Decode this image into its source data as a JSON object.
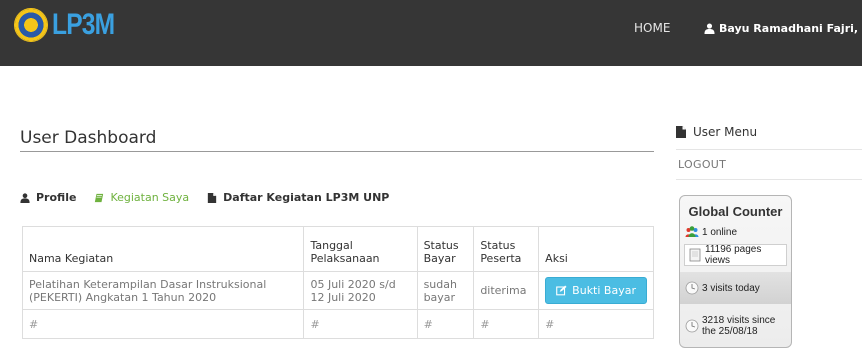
{
  "header": {
    "logo_text": "LP3M",
    "nav_home": "HOME",
    "user_name": "Bayu Ramadhani Fajri, Ph.D"
  },
  "main": {
    "title": "User Dashboard",
    "tabs": [
      {
        "label": "Profile",
        "active": false
      },
      {
        "label": "Kegiatan Saya",
        "active": true
      },
      {
        "label": "Daftar Kegiatan LP3M UNP",
        "active": false
      }
    ],
    "table": {
      "headers": [
        "Nama Kegiatan",
        "Tanggal Pelaksanaan",
        "Status Bayar",
        "Status Peserta",
        "Aksi"
      ],
      "rows": [
        {
          "nama": "Pelatihan Keterampilan Dasar Instruksional (PEKERTI) Angkatan 1 Tahun 2020",
          "tanggal": "05 Juli 2020 s/d 12 Juli 2020",
          "status_bayar": "sudah bayar",
          "status_peserta": "diterima",
          "aksi": "Bukti Bayar"
        },
        {
          "nama": "#",
          "tanggal": "#",
          "status_bayar": "#",
          "status_peserta": "#",
          "aksi": "#"
        }
      ]
    }
  },
  "sidebar": {
    "title": "User Menu",
    "logout": "LOGOUT",
    "counter": {
      "title": "Global Counter",
      "online": "1 online",
      "views": "11196 pages views",
      "today": "3 visits today",
      "since": "3218 visits since the 25/08/18"
    }
  },
  "colors": {
    "navbar": "#363636",
    "active_tab": "#6fb23f",
    "button": "#4bbde3",
    "logo": "#3aa0e0"
  }
}
